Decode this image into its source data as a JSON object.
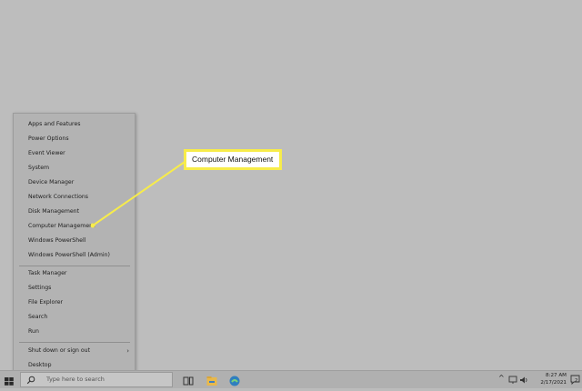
{
  "menu": {
    "group1": [
      {
        "label": "Apps and Features"
      },
      {
        "label": "Power Options"
      },
      {
        "label": "Event Viewer"
      },
      {
        "label": "System"
      },
      {
        "label": "Device Manager"
      },
      {
        "label": "Network Connections"
      },
      {
        "label": "Disk Management"
      },
      {
        "label": "Computer Management"
      },
      {
        "label": "Windows PowerShell"
      },
      {
        "label": "Windows PowerShell (Admin)"
      }
    ],
    "group2": [
      {
        "label": "Task Manager"
      },
      {
        "label": "Settings"
      },
      {
        "label": "File Explorer"
      },
      {
        "label": "Search"
      },
      {
        "label": "Run"
      }
    ],
    "group3": [
      {
        "label": "Shut down or sign out",
        "submenu_arrow": "›"
      },
      {
        "label": "Desktop"
      }
    ]
  },
  "callout": {
    "text": "Computer Management",
    "highlight_color": "#f7ec4a"
  },
  "taskbar": {
    "search_placeholder": "Type here to search",
    "icons": [
      "windows-start-icon",
      "search-icon",
      "task-view-icon",
      "file-explorer-icon",
      "edge-icon"
    ],
    "tray": {
      "chevron": "^",
      "notification_count": "2",
      "time": "8:27 AM",
      "date": "2/17/2021"
    }
  },
  "colors": {
    "desktop": "#bdbdbd",
    "menu_bg": "#b3b3b3",
    "taskbar_bg": "#b0b0b0",
    "callout_border": "#f7ec4a",
    "edge_blue": "#2f7fbf",
    "explorer_yellow": "#e8b84a"
  }
}
